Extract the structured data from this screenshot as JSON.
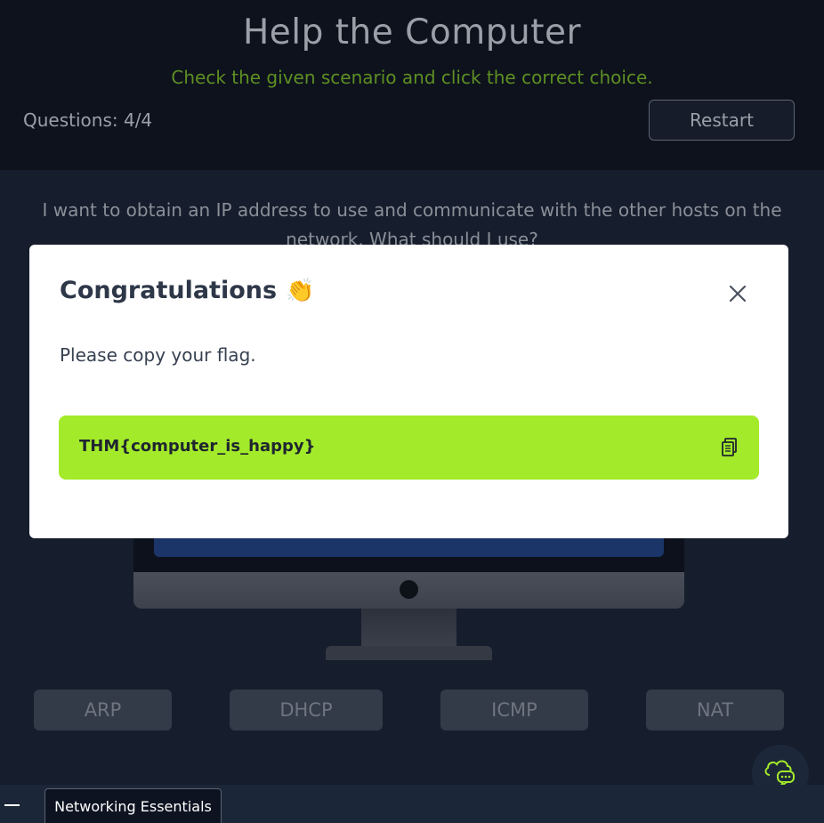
{
  "header": {
    "title": "Help the Computer",
    "subtitle": "Check the given scenario and click the correct choice.",
    "questions": "Questions: 4/4",
    "restart_label": "Restart"
  },
  "question": {
    "text": "I want to obtain an IP address to use and communicate with the other hosts on the network. What should I use?"
  },
  "choices": [
    {
      "label": "ARP"
    },
    {
      "label": "DHCP"
    },
    {
      "label": "ICMP"
    },
    {
      "label": "NAT"
    }
  ],
  "modal": {
    "title": "Congratulations",
    "title_emoji": "👏",
    "message": "Please copy your flag.",
    "flag": "THM{computer_is_happy}",
    "close_icon": "close-icon",
    "copy_icon": "copy-icon"
  },
  "taskbar": {
    "tab_label": "Networking Essentials"
  },
  "colors": {
    "accent_green": "#a3ea2a",
    "subtitle_green": "#5e8f22",
    "background": "#161d2c"
  }
}
